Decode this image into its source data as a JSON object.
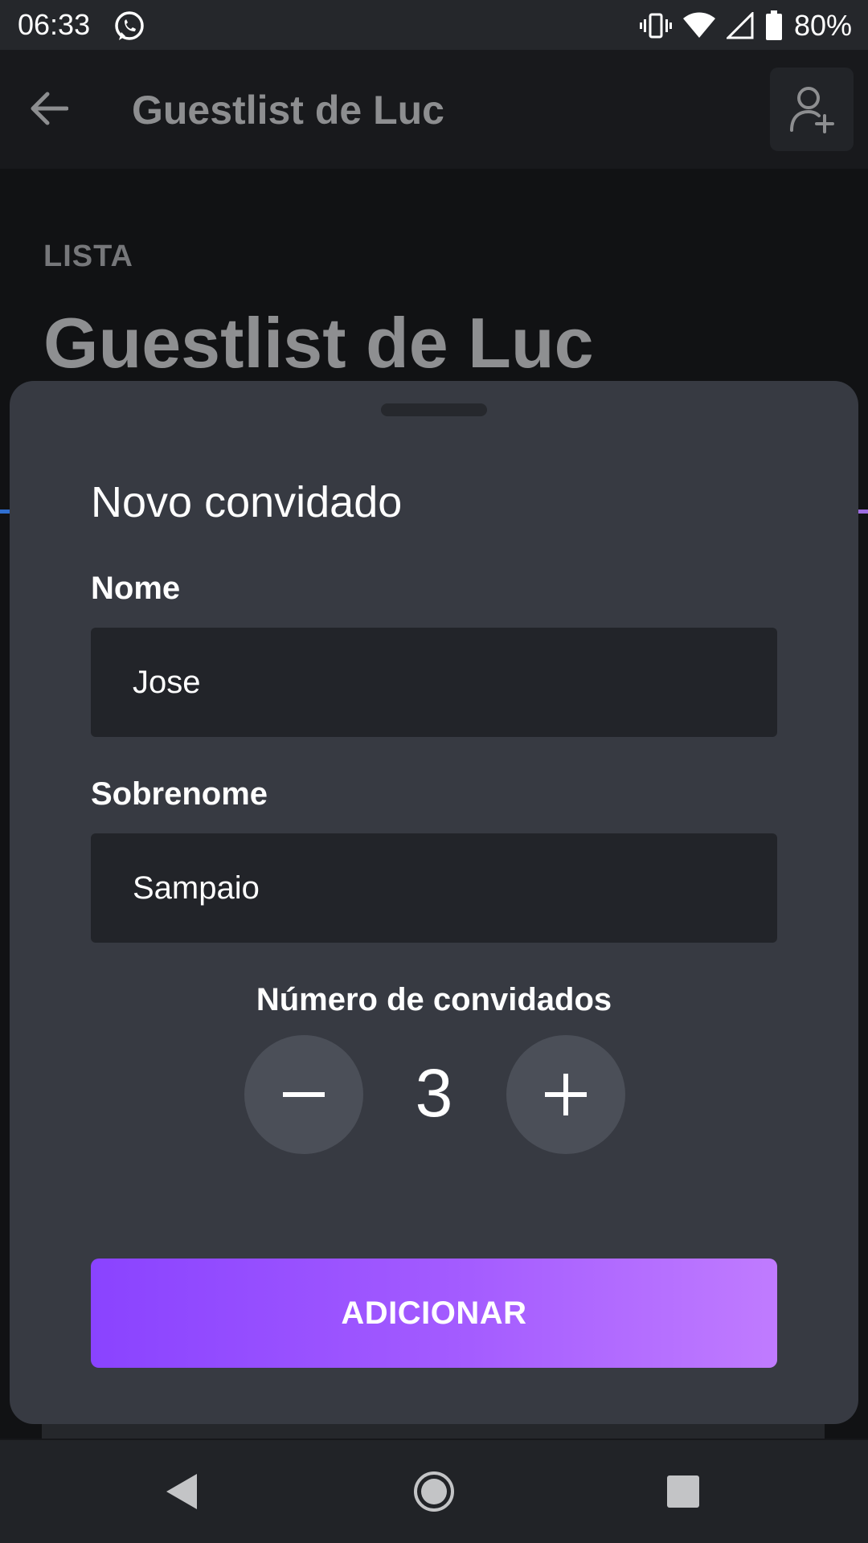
{
  "status_bar": {
    "time": "06:33",
    "battery": "80%",
    "icons": [
      "whatsapp-icon",
      "vibrate-icon",
      "wifi-icon",
      "signal-icon",
      "battery-icon"
    ]
  },
  "app_bar": {
    "title": "Guestlist de Luc",
    "icons": [
      "back-arrow-icon",
      "add-person-icon"
    ]
  },
  "page": {
    "section_label": "LISTA",
    "list_title": "Guestlist de Luc"
  },
  "sheet": {
    "title": "Novo convidado",
    "first_name_label": "Nome",
    "first_name_value": "Jose",
    "last_name_label": "Sobrenome",
    "last_name_value": "Sampaio",
    "guests_label": "Número de convidados",
    "guest_count": "3",
    "submit_label": "ADICIONAR"
  },
  "colors": {
    "sheet_bg": "#373a42",
    "field_bg": "#222429",
    "accent_start": "#8a43ff",
    "accent_end": "#c07bff"
  }
}
